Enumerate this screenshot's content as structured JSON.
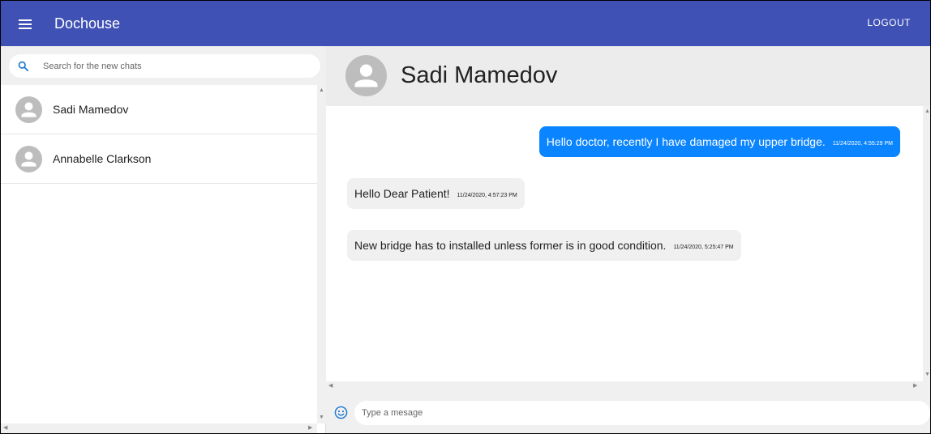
{
  "appbar": {
    "title": "Dochouse",
    "logout_label": "LOGOUT",
    "color": "#3f51b5"
  },
  "search": {
    "placeholder": "Search for the new chats",
    "value": ""
  },
  "chats": [
    {
      "name": "Sadi Mamedov"
    },
    {
      "name": "Annabelle Clarkson"
    }
  ],
  "conversation": {
    "contact_name": "Sadi Mamedov",
    "messages": [
      {
        "direction": "outgoing",
        "text": "Hello doctor, recently I have damaged my upper bridge.",
        "time": "11/24/2020, 4:55:29 PM"
      },
      {
        "direction": "incoming",
        "text": "Hello Dear Patient!",
        "time": "11/24/2020, 4:57:23 PM"
      },
      {
        "direction": "incoming",
        "text": "New bridge has to installed unless former is in good condition.",
        "time": "11/24/2020, 5:25:47 PM"
      }
    ]
  },
  "compose": {
    "placeholder": "Type a mesage",
    "value": ""
  },
  "colors": {
    "outgoing_bubble": "#0a84ff",
    "incoming_bubble": "#f0f0f0",
    "avatar": "#bdbdbd"
  },
  "icons": [
    "menu-icon",
    "search-icon",
    "avatar-icon",
    "emoji-icon"
  ]
}
